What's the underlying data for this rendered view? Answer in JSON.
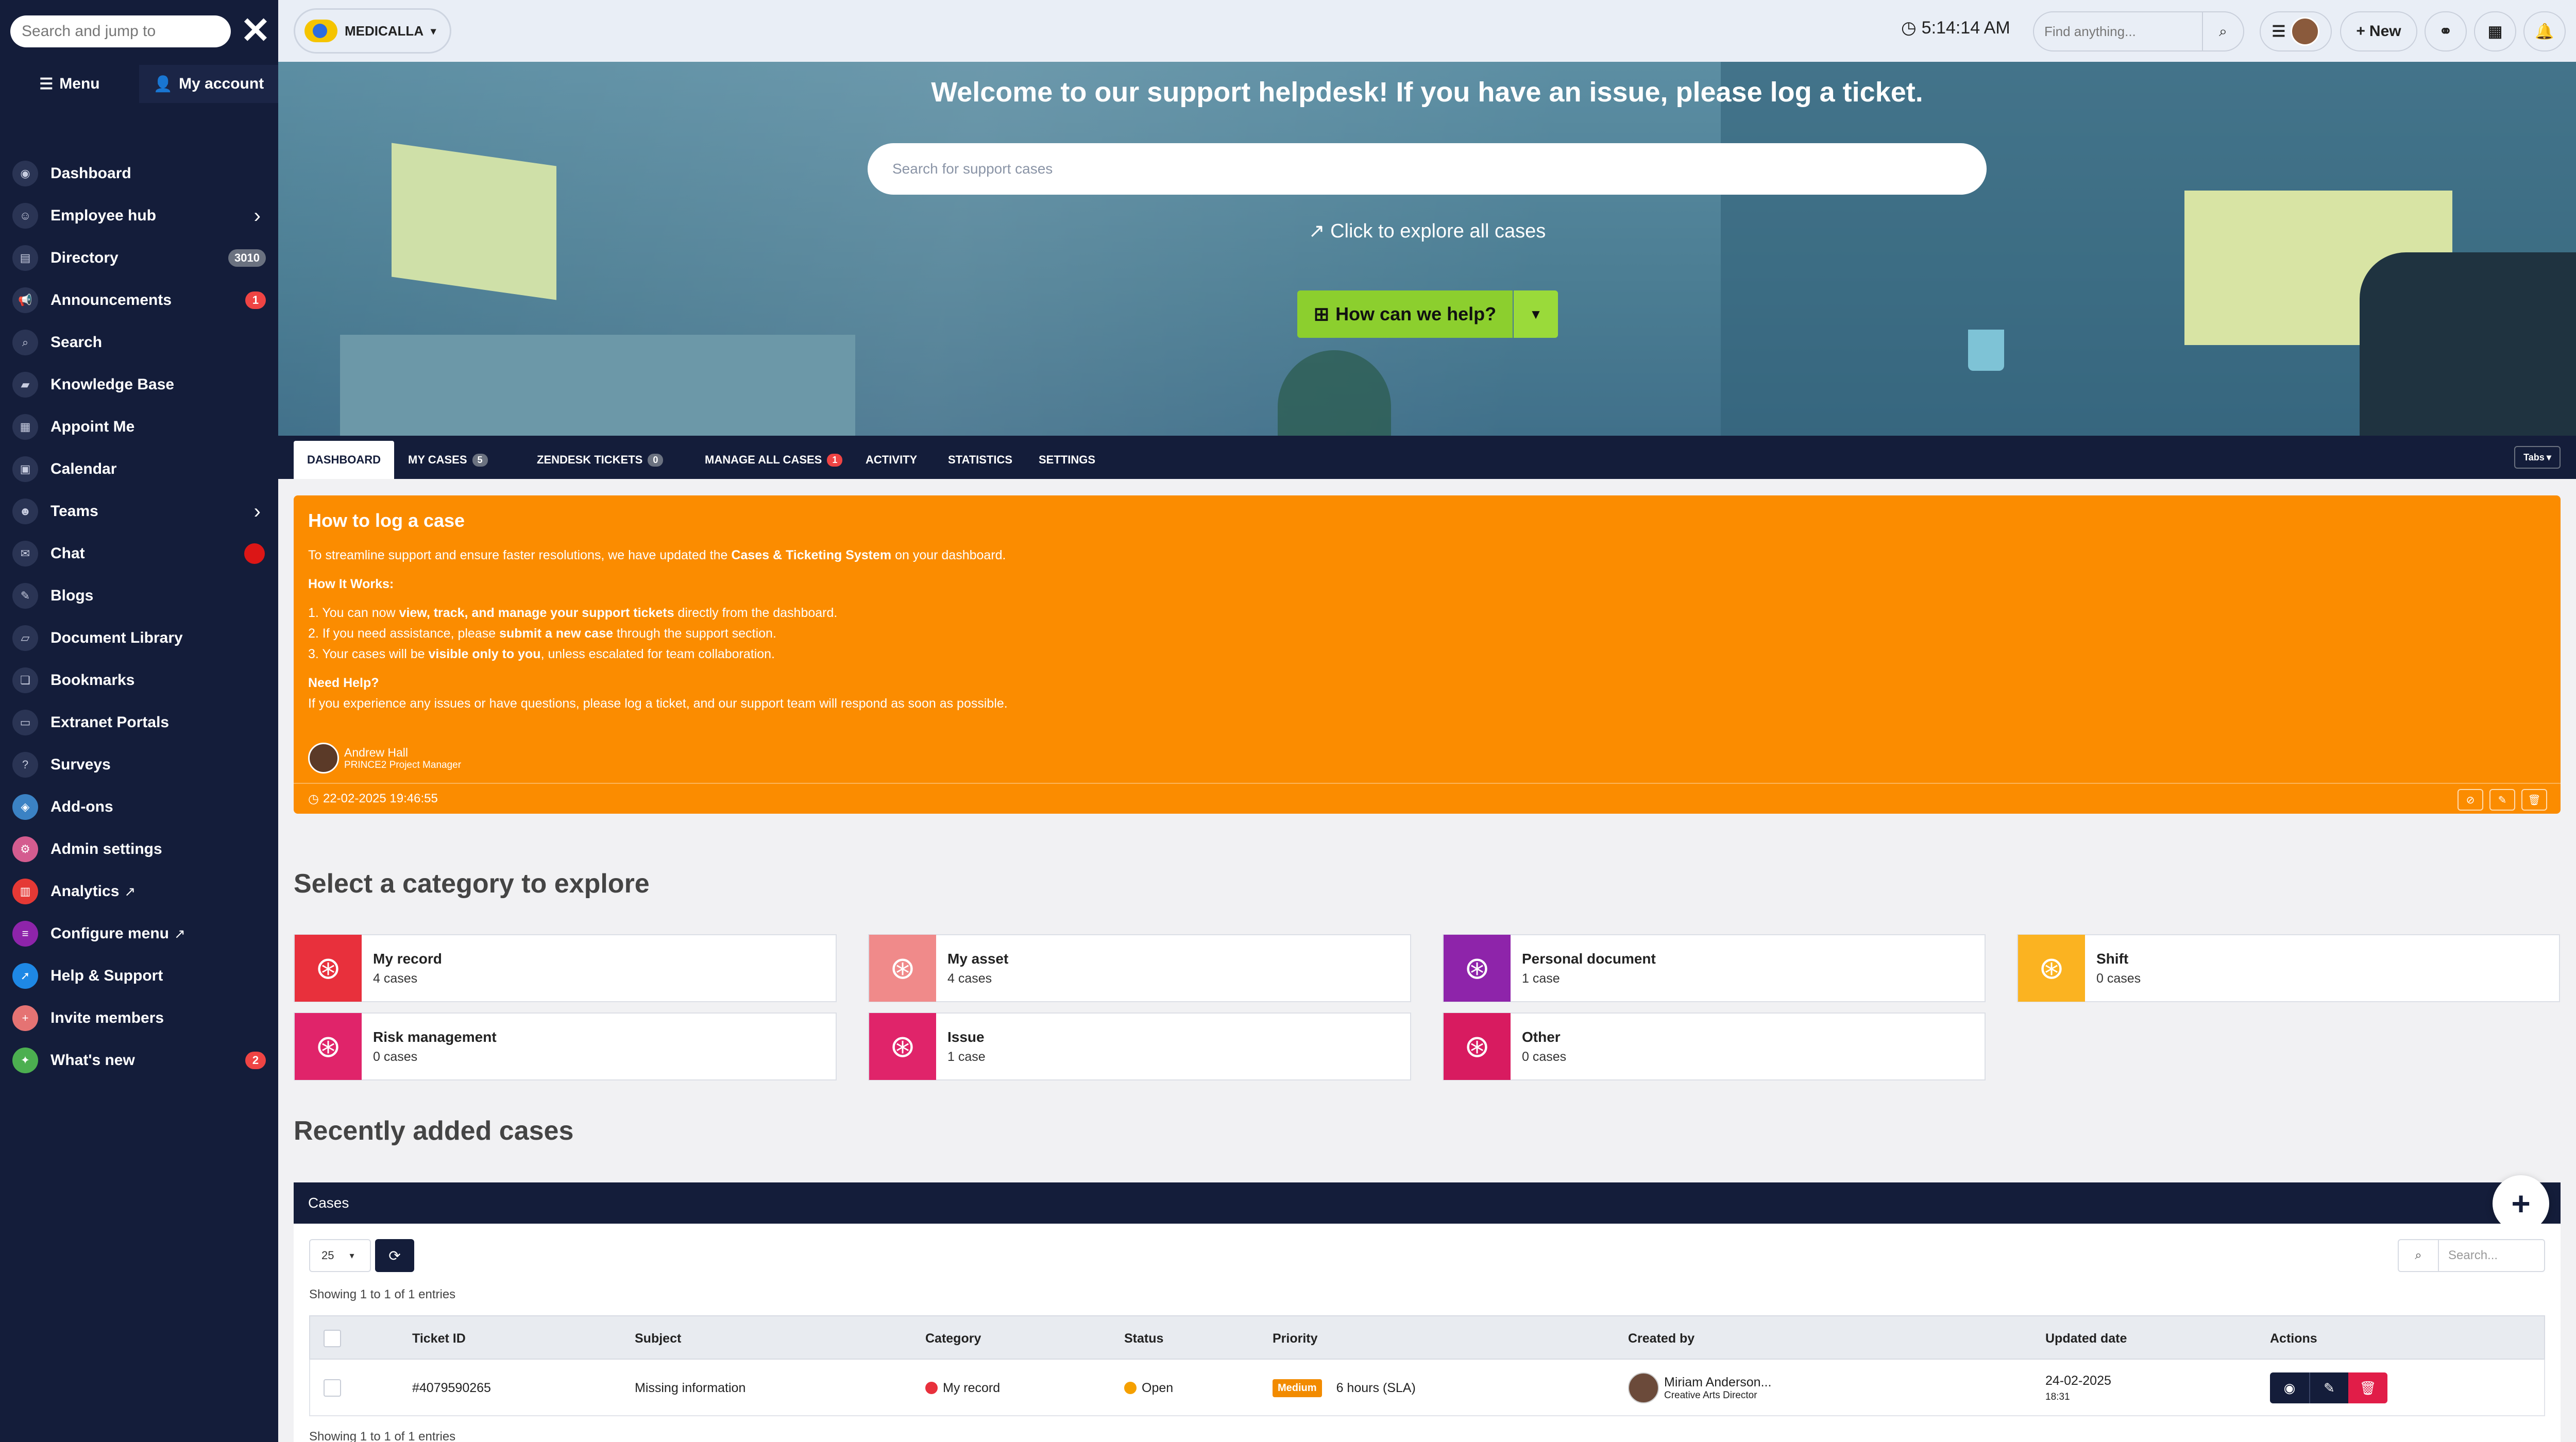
{
  "sidebar": {
    "search_placeholder": "Search and jump to",
    "menu_label": "Menu",
    "account_label": "My account",
    "items": [
      {
        "label": "Dashboard"
      },
      {
        "label": "Employee hub"
      },
      {
        "label": "Directory",
        "badge": "3010"
      },
      {
        "label": "Announcements",
        "badge": "1"
      },
      {
        "label": "Search"
      },
      {
        "label": "Knowledge Base"
      },
      {
        "label": "Appoint Me"
      },
      {
        "label": "Calendar"
      },
      {
        "label": "Teams"
      },
      {
        "label": "Chat"
      },
      {
        "label": "Blogs"
      },
      {
        "label": "Document Library"
      },
      {
        "label": "Bookmarks"
      },
      {
        "label": "Extranet Portals"
      },
      {
        "label": "Surveys"
      },
      {
        "label": "Add-ons"
      },
      {
        "label": "Admin settings"
      },
      {
        "label": "Analytics"
      },
      {
        "label": "Configure menu"
      },
      {
        "label": "Help & Support"
      },
      {
        "label": "Invite members"
      },
      {
        "label": "What's new",
        "badge": "2"
      }
    ]
  },
  "topbar": {
    "brand": "MEDICALLA",
    "time": "5:14:14 AM",
    "find_placeholder": "Find anything...",
    "new_label": "New"
  },
  "hero": {
    "title": "Welcome to our support helpdesk! If you have an issue, please log a ticket.",
    "search_placeholder": "Search for support cases",
    "explore_link": "Click to explore all cases",
    "help_button": "How can we help?"
  },
  "tabs": {
    "items": [
      {
        "label": "DASHBOARD"
      },
      {
        "label": "MY CASES",
        "count": "5"
      },
      {
        "label": "ZENDESK TICKETS",
        "count": "0"
      },
      {
        "label": "MANAGE ALL CASES",
        "count": "1"
      },
      {
        "label": "ACTIVITY"
      },
      {
        "label": "STATISTICS"
      },
      {
        "label": "SETTINGS"
      }
    ],
    "dropdown": "Tabs"
  },
  "announcement": {
    "title": "How to log a case",
    "intro_pre": "To streamline support and ensure faster resolutions, we have updated the ",
    "intro_bold": "Cases & Ticketing System",
    "intro_post": " on your dashboard.",
    "how_heading": "How It Works:",
    "steps": [
      {
        "pre": "1. You can now ",
        "bold": "view, track, and manage your support tickets",
        "post": " directly from the dashboard."
      },
      {
        "pre": "2. If you need assistance, please ",
        "bold": "submit a new case",
        "post": " through the support section."
      },
      {
        "pre": "3. Your cases will be ",
        "bold": "visible only to you",
        "post": ", unless escalated for team collaboration."
      }
    ],
    "help_heading": "Need Help?",
    "help_text": "If you experience any issues or have questions, please log a ticket, and our support team will respond as soon as possible.",
    "author_name": "Andrew Hall",
    "author_role": "PRINCE2 Project Manager",
    "timestamp": "22-02-2025 19:46:55"
  },
  "categories": {
    "title": "Select a category to explore",
    "items": [
      {
        "name": "My record",
        "count": "4 cases",
        "color": "#e8303c"
      },
      {
        "name": "My asset",
        "count": "4 cases",
        "color": "#f08a8a"
      },
      {
        "name": "Personal document",
        "count": "1 case",
        "color": "#8e24aa"
      },
      {
        "name": "Shift",
        "count": "0 cases",
        "color": "#fbb321"
      },
      {
        "name": "Risk management",
        "count": "0 cases",
        "color": "#e0246a"
      },
      {
        "name": "Issue",
        "count": "1 case",
        "color": "#e0246a"
      },
      {
        "name": "Other",
        "count": "0 cases",
        "color": "#d81b60"
      }
    ]
  },
  "recent": {
    "title": "Recently added cases",
    "card_title": "Cases",
    "page_size": "25",
    "search_placeholder": "Search...",
    "showing": "Showing 1 to 1 of 1 entries",
    "columns": [
      "Ticket ID",
      "Subject",
      "Category",
      "Status",
      "Priority",
      "Created by",
      "Updated date",
      "Actions"
    ],
    "rows": [
      {
        "ticket_id": "#4079590265",
        "subject": "Missing information",
        "category": "My record",
        "status": "Open",
        "priority": "Medium",
        "sla": "6 hours (SLA)",
        "created_by": "Miriam Anderson...",
        "created_role": "Creative Arts Director",
        "updated_date": "24-02-2025",
        "updated_time": "18:31"
      }
    ]
  }
}
